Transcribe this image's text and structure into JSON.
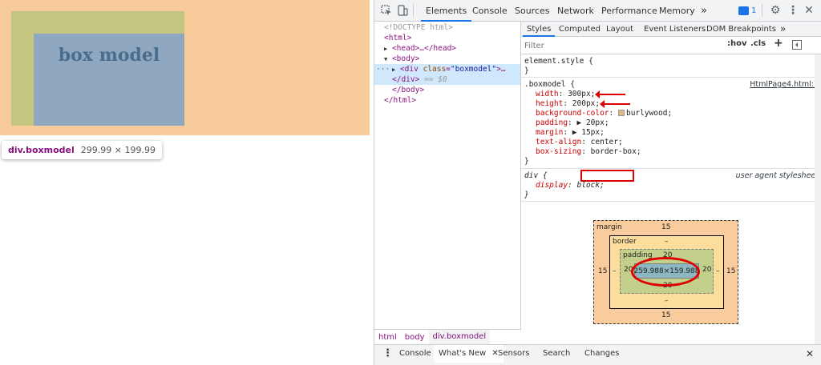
{
  "page": {
    "box_text": "box model",
    "tooltip": {
      "tag": "div.boxmodel",
      "size": "299.99 × 199.99"
    }
  },
  "devtools": {
    "toolbar": {
      "tabs": [
        "Elements",
        "Console",
        "Sources",
        "Network",
        "Performance",
        "Memory"
      ],
      "active_tab": "Elements",
      "more": "»",
      "issues_count": "1"
    },
    "dom": {
      "doctype": "<!DOCTYPE html>",
      "html_open": "<html>",
      "head": "<head>…</head>",
      "body_open": "<body>",
      "div_tag": "<div ",
      "div_attr_name": "class",
      "div_attr_value": "\"boxmodel\"",
      "div_close_bracket": ">…",
      "div_end": "</div>",
      "div_end_suffix": " == $0",
      "body_close": "</body>",
      "html_close": "</html>",
      "ellipsis": "···"
    },
    "breadcrumbs": [
      "html",
      "body",
      "div.boxmodel"
    ],
    "styles": {
      "subtabs": [
        "Styles",
        "Computed",
        "Layout",
        "Event Listeners",
        "DOM Breakpoints"
      ],
      "active_subtab": "Styles",
      "subtabs_more": "»",
      "filter_placeholder": "Filter",
      "hov": ":hov",
      ".cls": ".cls",
      "plus": "+",
      "element_style": "element.style {",
      "close_brace": "}",
      "rule_selector": ".boxmodel {",
      "rule_source": "HtmlPage4.html:7",
      "declarations": [
        {
          "name": "width",
          "value": "300px;"
        },
        {
          "name": "height",
          "value": "200px;"
        },
        {
          "name": "background-color",
          "value": "burlywood;"
        },
        {
          "name": "padding",
          "value": "▶ 20px;"
        },
        {
          "name": "margin",
          "value": "▶ 15px;"
        },
        {
          "name": "text-align",
          "value": "center;"
        },
        {
          "name": "box-sizing",
          "value": "border-box;"
        }
      ],
      "ua_selector": "div {",
      "ua_source": "user agent stylesheet",
      "ua_decl_name": "display",
      "ua_decl_value": "block;"
    },
    "box_model": {
      "margin_label": "margin",
      "margin": {
        "top": "15",
        "right": "15",
        "bottom": "15",
        "left": "15"
      },
      "border_label": "border",
      "border": {
        "top": "–",
        "right": "–",
        "bottom": "–",
        "left": "–"
      },
      "padding_label": "padding",
      "padding": {
        "top": "20",
        "right": "20",
        "bottom": "20",
        "left": "20"
      },
      "content": "259.988×159.988"
    },
    "drawer": {
      "tabs": [
        "Console",
        "What's New",
        "Sensors",
        "Search",
        "Changes"
      ],
      "active_tab": "What's New"
    }
  },
  "colors": {
    "margin_highlight": "#f7cb9a",
    "padding_highlight": "#c3c581",
    "content_highlight": "#8fa8c0",
    "annotation_red": "#e00000",
    "accent": "#1a73e8"
  }
}
